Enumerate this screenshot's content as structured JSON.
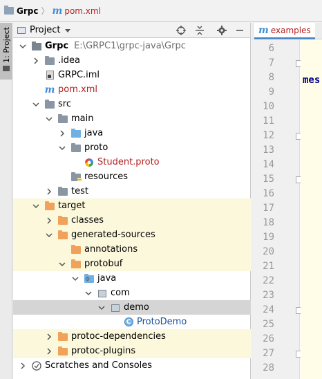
{
  "navbar": {
    "items": [
      {
        "label": "Grpc",
        "icon": "folder-icon"
      },
      {
        "label": "pom.xml",
        "icon": "maven-icon"
      }
    ]
  },
  "left_stripe": {
    "tab_label": "1: Project"
  },
  "project_panel": {
    "title": "Project",
    "header_buttons": [
      "locate-icon",
      "collapse-all-icon",
      "settings-icon",
      "hide-icon"
    ]
  },
  "tree": [
    {
      "label": "Grpc",
      "path": "E:\\GRPC1\\grpc-java\\Grpc",
      "depth": 0,
      "expanded": true,
      "icon": "module-folder"
    },
    {
      "label": ".idea",
      "depth": 1,
      "expanded": false,
      "icon": "folder-gray"
    },
    {
      "label": "GRPC.iml",
      "depth": 1,
      "icon": "iml-file"
    },
    {
      "label": "pom.xml",
      "depth": 1,
      "icon": "maven-file"
    },
    {
      "label": "src",
      "depth": 1,
      "expanded": true,
      "icon": "folder-gray"
    },
    {
      "label": "main",
      "depth": 2,
      "expanded": true,
      "icon": "folder-gray"
    },
    {
      "label": "java",
      "depth": 3,
      "expanded": false,
      "icon": "folder-blue"
    },
    {
      "label": "proto",
      "depth": 3,
      "expanded": true,
      "icon": "folder-gray"
    },
    {
      "label": "Student.proto",
      "depth": 4,
      "icon": "proto-file"
    },
    {
      "label": "resources",
      "depth": 3,
      "icon": "resources-folder"
    },
    {
      "label": "test",
      "depth": 2,
      "expanded": false,
      "icon": "folder-gray"
    },
    {
      "label": "target",
      "depth": 1,
      "expanded": true,
      "icon": "folder-orange"
    },
    {
      "label": "classes",
      "depth": 2,
      "expanded": false,
      "icon": "folder-orange"
    },
    {
      "label": "generated-sources",
      "depth": 2,
      "expanded": true,
      "icon": "folder-orange"
    },
    {
      "label": "annotations",
      "depth": 3,
      "icon": "folder-orange"
    },
    {
      "label": "protobuf",
      "depth": 3,
      "expanded": true,
      "icon": "folder-orange"
    },
    {
      "label": "java",
      "depth": 4,
      "expanded": true,
      "icon": "generated-source-folder"
    },
    {
      "label": "com",
      "depth": 5,
      "expanded": true,
      "icon": "package"
    },
    {
      "label": "demo",
      "depth": 6,
      "expanded": true,
      "icon": "package"
    },
    {
      "label": "ProtoDemo",
      "depth": 7,
      "icon": "class"
    },
    {
      "label": "protoc-dependencies",
      "depth": 2,
      "expanded": false,
      "icon": "folder-orange"
    },
    {
      "label": "protoc-plugins",
      "depth": 2,
      "expanded": false,
      "icon": "folder-orange"
    },
    {
      "label": "Scratches and Consoles",
      "depth": 0,
      "expanded": false,
      "icon": "scratches"
    }
  ],
  "editor": {
    "tab_label": "examples",
    "line_numbers": [
      "6",
      "7",
      "8",
      "9",
      "10",
      "11",
      "12",
      "13",
      "14",
      "15",
      "16",
      "17",
      "18",
      "19",
      "20",
      "21",
      "22",
      "23",
      "24",
      "25",
      "26",
      "27",
      "28"
    ],
    "code_fragment": "mes"
  },
  "colors": {
    "excluded_bg": "#fbf8dc",
    "selected_bg": "#d5d5d5",
    "folder_orange": "#f0a15a",
    "folder_blue": "#6fb1e5",
    "accent": "#4a88c7"
  }
}
